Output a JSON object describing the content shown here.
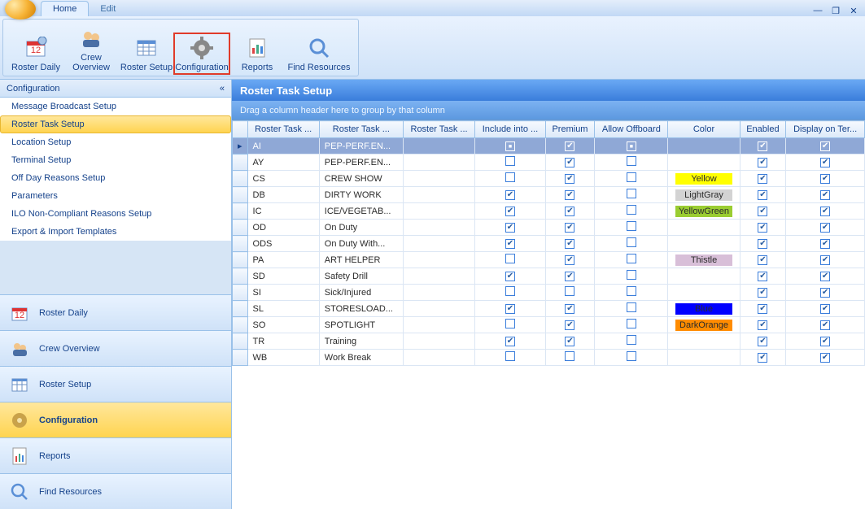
{
  "tabs": {
    "home": "Home",
    "edit": "Edit"
  },
  "ribbon": {
    "roster_daily": "Roster Daily",
    "crew_overview": "Crew Overview",
    "roster_setup": "Roster Setup",
    "configuration": "Configuration",
    "reports": "Reports",
    "find_resources": "Find Resources"
  },
  "sidebar": {
    "header": "Configuration",
    "items": [
      "Message Broadcast Setup",
      "Roster Task Setup",
      "Location Setup",
      "Terminal Setup",
      "Off Day Reasons Setup",
      "Parameters",
      "ILO Non-Compliant Reasons Setup",
      "Export & Import Templates"
    ],
    "selected_index": 1
  },
  "nav": {
    "items": [
      "Roster Daily",
      "Crew Overview",
      "Roster Setup",
      "Configuration",
      "Reports",
      "Find Resources"
    ],
    "selected_index": 3
  },
  "main": {
    "title": "Roster Task Setup",
    "group_hint": "Drag a column header here to group by that column",
    "columns": [
      "Roster Task ...",
      "Roster Task ...",
      "Roster Task ...",
      "Include into ...",
      "Premium",
      "Allow Offboard",
      "Color",
      "Enabled",
      "Display on Ter..."
    ],
    "rows": [
      {
        "code": "AI",
        "name": "PEP-PERF.EN...",
        "blank": "",
        "include": "ind",
        "premium": "chk",
        "offboard": "ind",
        "color": "",
        "colorName": "",
        "enabled": "chk",
        "display": "chk",
        "selected": true
      },
      {
        "code": "AY",
        "name": "PEP-PERF.EN...",
        "blank": "",
        "include": "no",
        "premium": "chk",
        "offboard": "no",
        "color": "",
        "colorName": "",
        "enabled": "chk",
        "display": "chk"
      },
      {
        "code": "CS",
        "name": "CREW SHOW",
        "blank": "",
        "include": "no",
        "premium": "chk",
        "offboard": "no",
        "color": "#ffff00",
        "colorName": "Yellow",
        "enabled": "chk",
        "display": "chk"
      },
      {
        "code": "DB",
        "name": "DIRTY WORK",
        "blank": "",
        "include": "chk",
        "premium": "chk",
        "offboard": "no",
        "color": "#d3d3d3",
        "colorName": "LightGray",
        "enabled": "chk",
        "display": "chk"
      },
      {
        "code": "IC",
        "name": "ICE/VEGETAB...",
        "blank": "",
        "include": "chk",
        "premium": "chk",
        "offboard": "no",
        "color": "#9acd32",
        "colorName": "YellowGreen",
        "enabled": "chk",
        "display": "chk"
      },
      {
        "code": "OD",
        "name": "On Duty",
        "blank": "",
        "include": "chk",
        "premium": "chk",
        "offboard": "no",
        "color": "",
        "colorName": "",
        "enabled": "chk",
        "display": "chk"
      },
      {
        "code": "ODS",
        "name": "On Duty With...",
        "blank": "",
        "include": "chk",
        "premium": "chk",
        "offboard": "no",
        "color": "",
        "colorName": "",
        "enabled": "chk",
        "display": "chk"
      },
      {
        "code": "PA",
        "name": "ART HELPER",
        "blank": "",
        "include": "no",
        "premium": "chk",
        "offboard": "no",
        "color": "#d8bfd8",
        "colorName": "Thistle",
        "enabled": "chk",
        "display": "chk"
      },
      {
        "code": "SD",
        "name": "Safety Drill",
        "blank": "",
        "include": "chk",
        "premium": "chk",
        "offboard": "no",
        "color": "",
        "colorName": "",
        "enabled": "chk",
        "display": "chk"
      },
      {
        "code": "SI",
        "name": "Sick/Injured",
        "blank": "",
        "include": "no",
        "premium": "no",
        "offboard": "no",
        "color": "",
        "colorName": "",
        "enabled": "chk",
        "display": "chk"
      },
      {
        "code": "SL",
        "name": "STORESLOAD...",
        "blank": "",
        "include": "chk",
        "premium": "chk",
        "offboard": "no",
        "color": "#0000ff",
        "colorName": "Blue",
        "enabled": "chk",
        "display": "chk"
      },
      {
        "code": "SO",
        "name": "SPOTLIGHT",
        "blank": "",
        "include": "no",
        "premium": "chk",
        "offboard": "no",
        "color": "#ff8c00",
        "colorName": "DarkOrange",
        "enabled": "chk",
        "display": "chk"
      },
      {
        "code": "TR",
        "name": "Training",
        "blank": "",
        "include": "chk",
        "premium": "chk",
        "offboard": "no",
        "color": "",
        "colorName": "",
        "enabled": "chk",
        "display": "chk"
      },
      {
        "code": "WB",
        "name": "Work Break",
        "blank": "",
        "include": "no",
        "premium": "no",
        "offboard": "no",
        "color": "",
        "colorName": "",
        "enabled": "chk",
        "display": "chk"
      }
    ]
  }
}
